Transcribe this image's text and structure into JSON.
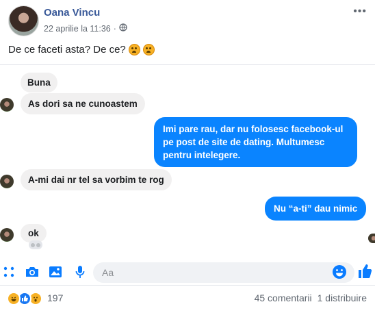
{
  "post": {
    "author": "Oana Vincu",
    "date": "22 aprilie la 11:36",
    "separator": "·",
    "more_label": "•••",
    "text": "De ce faceti asta? De ce?"
  },
  "chat": {
    "messages": [
      {
        "side": "in",
        "text": "Buna"
      },
      {
        "side": "in",
        "text": "As dori sa ne cunoastem"
      },
      {
        "side": "out",
        "text": "Imi pare rau, dar nu folosesc facebook-ul pe post de site de dating. Multumesc pentru intelegere."
      },
      {
        "side": "in",
        "text": "A-mi dai nr tel sa vorbim te rog"
      },
      {
        "side": "out",
        "text": "Nu “a-ti” dau nimic"
      },
      {
        "side": "in",
        "text": "ok"
      }
    ]
  },
  "composer": {
    "placeholder": "Aa",
    "icons": [
      "apps-icon",
      "camera-icon",
      "photo-icon",
      "microphone-icon",
      "emoji-icon",
      "like-icon"
    ]
  },
  "footer": {
    "reactions": [
      "haha",
      "like",
      "wow"
    ],
    "reaction_count": "197",
    "comments": "45 comentarii",
    "shares": "1 distribuire"
  },
  "colors": {
    "brand": "#385898",
    "bubble_out": "#0a84ff",
    "bubble_in": "#f1f0f0",
    "icon_blue": "#0a7cff"
  }
}
